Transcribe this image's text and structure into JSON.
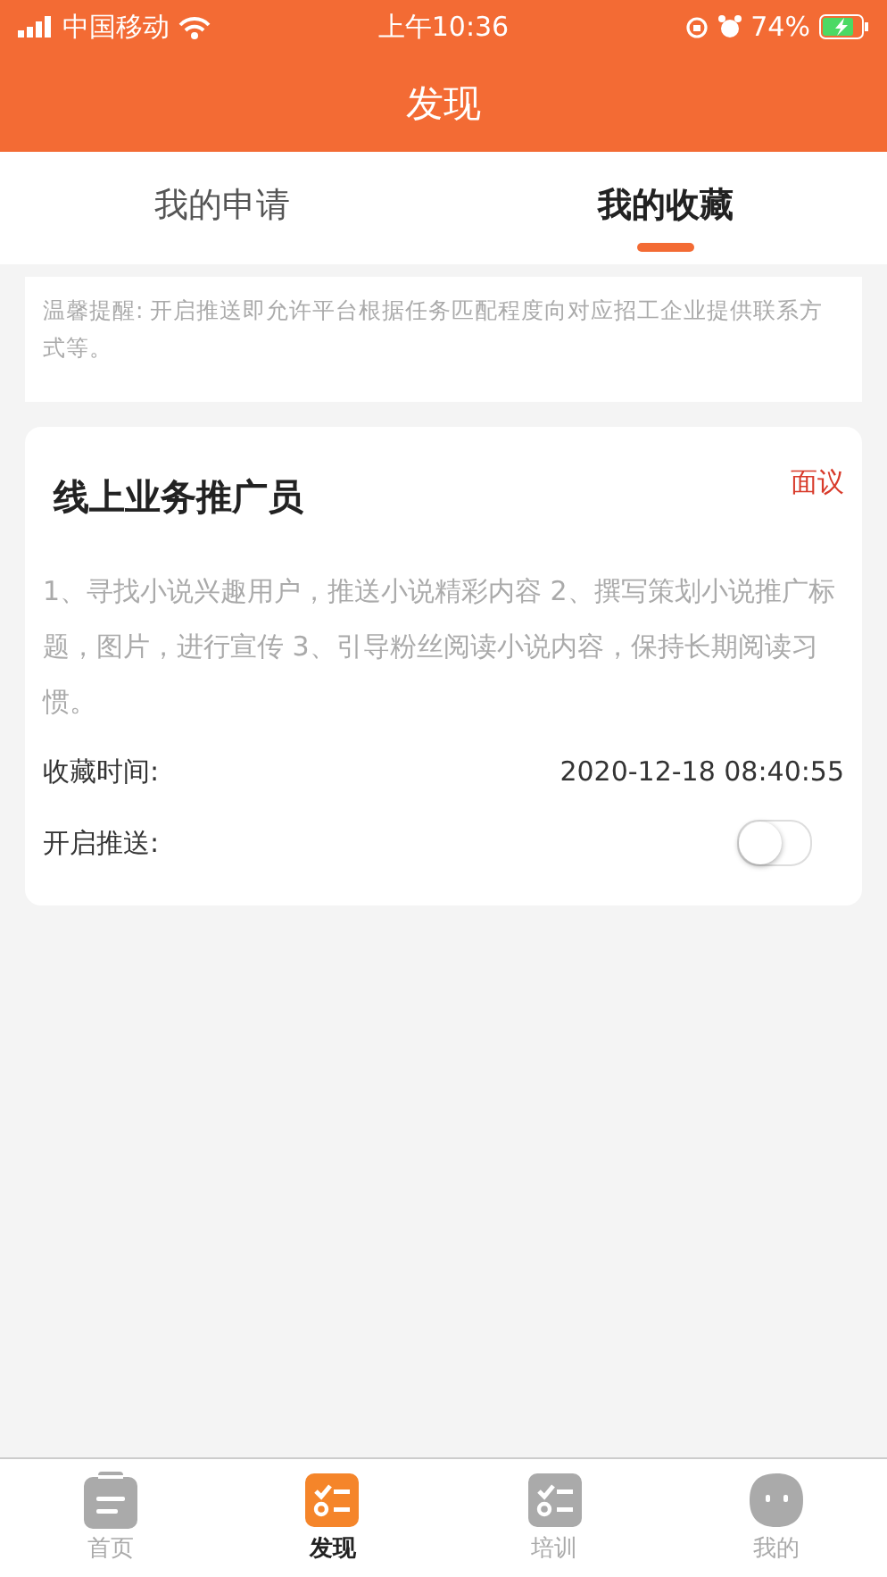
{
  "status_bar": {
    "carrier": "中国移动",
    "time": "上午10:36",
    "battery": "74%"
  },
  "header": {
    "title": "发现"
  },
  "tabs": [
    {
      "label": "我的申请",
      "selected": false
    },
    {
      "label": "我的收藏",
      "selected": true
    }
  ],
  "notice": "温馨提醒: 开启推送即允许平台根据任务匹配程度向对应招工企业提供联系方式等。",
  "favorites": [
    {
      "title": "线上业务推广员",
      "salary": "面议",
      "description": "1、寻找小说兴趣用户，推送小说精彩内容 2、撰写策划小说推广标题，图片，进行宣传 3、引导粉丝阅读小说内容，保持长期阅读习惯。",
      "time_label": "收藏时间:",
      "time": "2020-12-18 08:40:55",
      "push_label": "开启推送:",
      "push_on": false
    }
  ],
  "bottom_nav": [
    {
      "label": "首页",
      "kind": "home",
      "selected": false
    },
    {
      "label": "发现",
      "kind": "list",
      "selected": true
    },
    {
      "label": "培训",
      "kind": "list",
      "selected": false
    },
    {
      "label": "我的",
      "kind": "face",
      "selected": false
    }
  ]
}
